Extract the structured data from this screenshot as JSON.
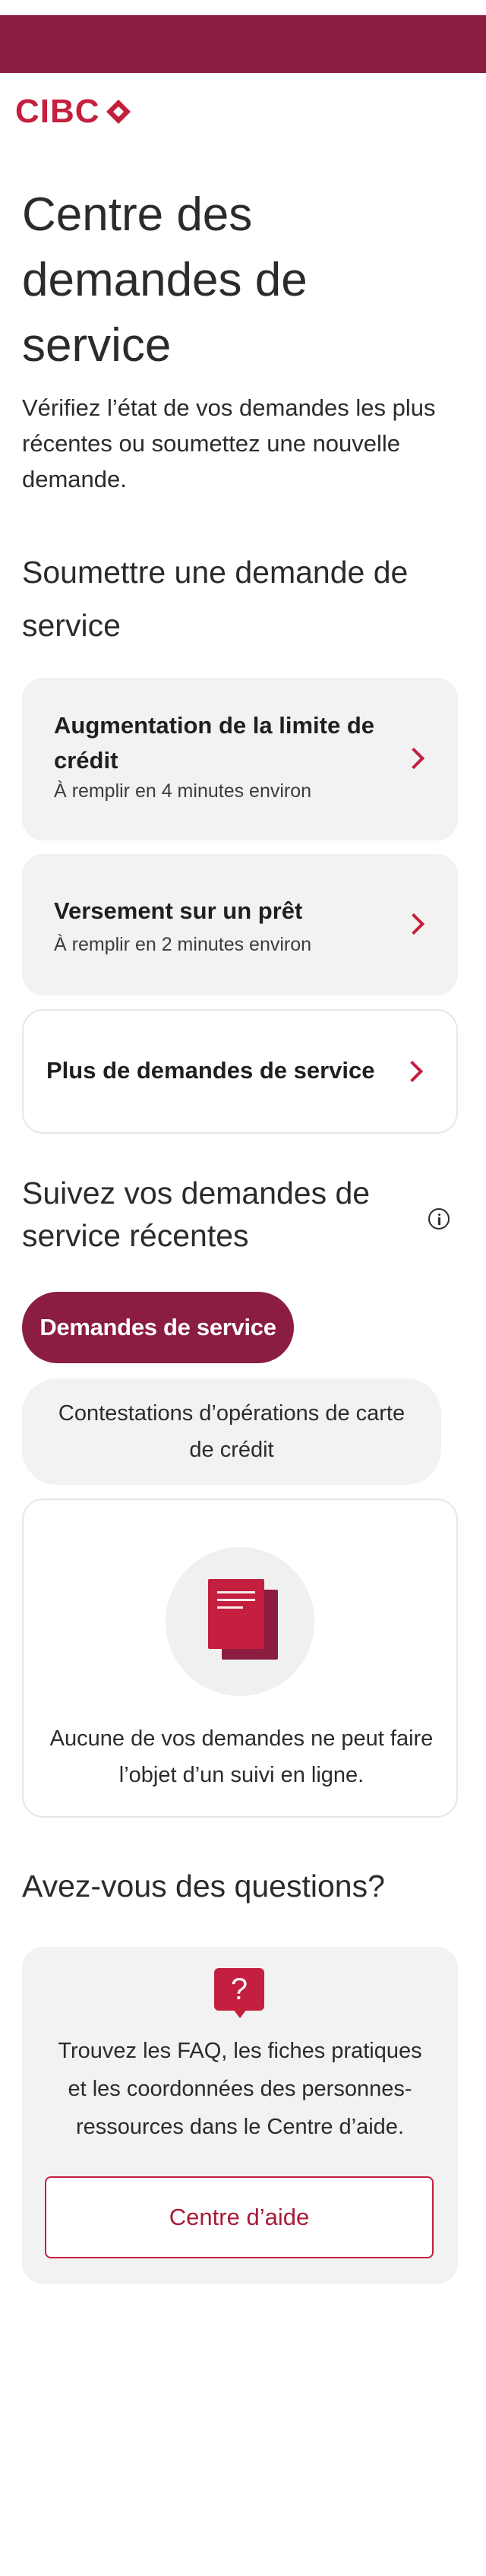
{
  "colors": {
    "brand": "#c41f3e",
    "brand_dark": "#8b1d41",
    "card_bg": "#f2f2f2"
  },
  "logo": {
    "text": "CIBC"
  },
  "page": {
    "title": "Centre des demandes de service",
    "intro": "Vérifiez l’état de vos demandes les plus récentes ou soumettez une nouvelle demande."
  },
  "submit_section": {
    "heading": "Soumettre une demande de service",
    "cards": [
      {
        "title": "Augmentation de la limite de crédit",
        "subtitle": "À remplir en 4 minutes environ"
      },
      {
        "title": "Versement sur un prêt",
        "subtitle": "À remplir en 2 minutes environ"
      },
      {
        "title": "Plus de demandes de service"
      }
    ]
  },
  "track_section": {
    "heading": "Suivez vos demandes de service récentes",
    "tabs": [
      {
        "label": "Demandes de service",
        "active": true
      },
      {
        "label": "Contestations d’opérations de carte de crédit",
        "active": false
      }
    ],
    "empty_message": "Aucune de vos demandes ne peut faire l’objet d’un suivi en ligne."
  },
  "help_section": {
    "heading": "Avez-vous des questions?",
    "icon_glyph": "?",
    "text": "Trouvez les FAQ, les fiches pratiques et les coordonnées des personnes-ressources dans le Centre d’aide.",
    "button_label": "Centre d’aide"
  }
}
